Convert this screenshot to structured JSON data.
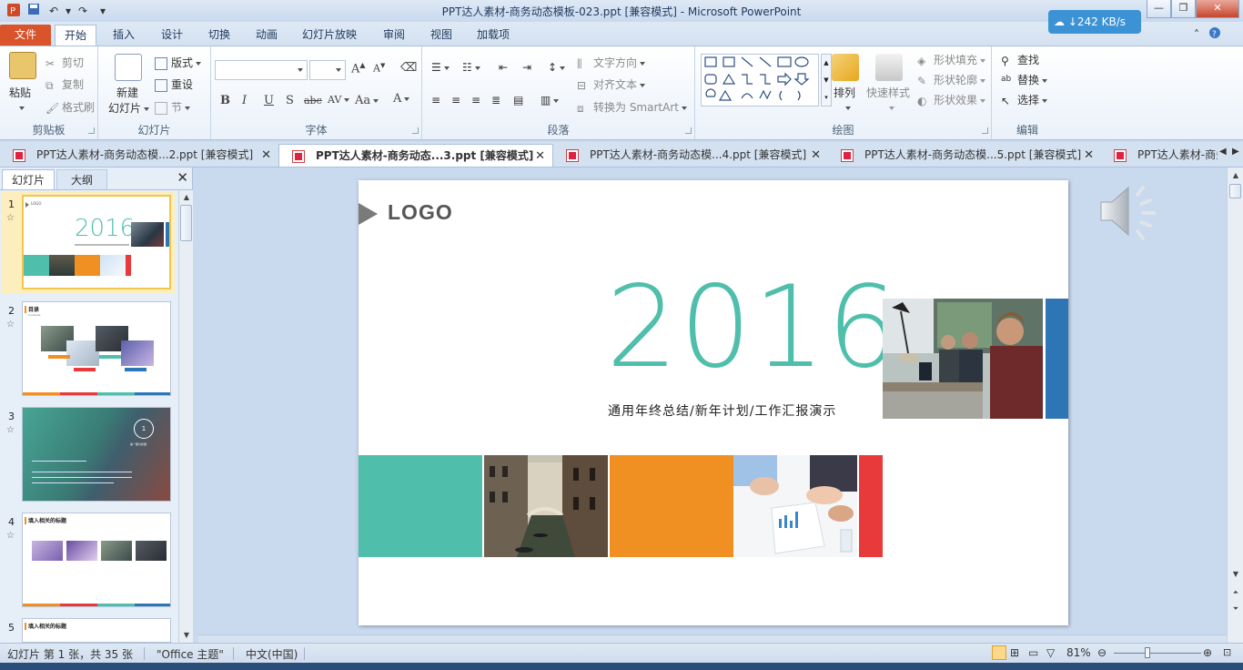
{
  "window": {
    "title": "PPT达人素材-商务动态模板-023.ppt [兼容模式]  -  Microsoft PowerPoint",
    "net_speed": "242 KB/s"
  },
  "ribbon_tabs": [
    "文件",
    "开始",
    "插入",
    "设计",
    "切换",
    "动画",
    "幻灯片放映",
    "审阅",
    "视图",
    "加载项"
  ],
  "ribbon": {
    "clipboard": {
      "paste": "粘贴",
      "cut": "剪切",
      "copy": "复制",
      "format_painter": "格式刷",
      "label": "剪贴板"
    },
    "slides": {
      "new_slide_line1": "新建",
      "new_slide_line2": "幻灯片",
      "layout": "版式",
      "reset": "重设",
      "section": "节",
      "label": "幻灯片"
    },
    "font": {
      "label": "字体",
      "bold": "B",
      "italic": "I",
      "underline": "U",
      "shadow": "S",
      "strike": "abc",
      "spacing": "AV",
      "case": "Aa",
      "color": "A",
      "grow": "A",
      "shrink": "A"
    },
    "paragraph": {
      "text_direction": "文字方向",
      "align_text": "对齐文本",
      "smartart": "转换为 SmartArt",
      "label": "段落"
    },
    "drawing": {
      "arrange": "排列",
      "quick_styles": "快速样式",
      "shape_fill": "形状填充",
      "shape_outline": "形状轮廓",
      "shape_effects": "形状效果",
      "label": "绘图"
    },
    "editing": {
      "find": "查找",
      "replace": "替换",
      "select": "选择",
      "label": "编辑"
    }
  },
  "doc_tabs": [
    "PPT达人素材-商务动态模...2.ppt [兼容模式]",
    "PPT达人素材-商务动态...3.ppt [兼容模式]",
    "PPT达人素材-商务动态模...4.ppt [兼容模式]",
    "PPT达人素材-商务动态模...5.ppt [兼容模式]",
    "PPT达人素材-商务"
  ],
  "pane": {
    "tab_slides": "幻灯片",
    "tab_outline": "大纲"
  },
  "thumbnails": [
    {
      "num": "1",
      "logo": "LOGO",
      "year": "2016"
    },
    {
      "num": "2",
      "title": "目录",
      "sub": "Contents"
    },
    {
      "num": "3",
      "badge": "1",
      "title": "第一部分标题"
    },
    {
      "num": "4",
      "title": "填入相关的标题"
    },
    {
      "num": "5",
      "title": "填入相关的标题"
    }
  ],
  "slide": {
    "logo": "LOGO",
    "year": "2016",
    "subtitle": "通用年终总结/新年计划/工作汇报演示"
  },
  "status": {
    "slide_info": "幻灯片 第 1 张，共 35 张",
    "theme": "\"Office 主题\"",
    "language": "中文(中国)",
    "zoom": "81%"
  },
  "colors": {
    "teal": "#4fbfac",
    "orange": "#f19022",
    "red": "#e83a3a",
    "blue": "#2e75b6"
  }
}
